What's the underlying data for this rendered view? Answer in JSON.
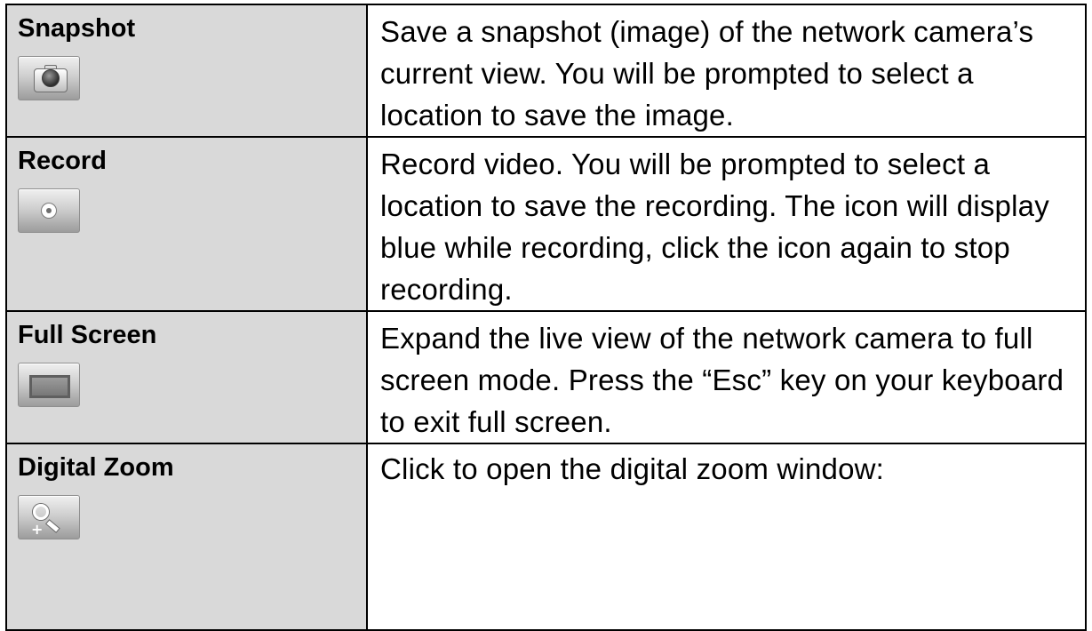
{
  "rows": [
    {
      "name": "Snapshot",
      "icon": "camera-icon",
      "description": "Save a snapshot (image) of the network camera’s current view. You will be prompted to select a location to save the image."
    },
    {
      "name": "Record",
      "icon": "record-icon",
      "description": "Record video. You will be prompted to select a location to save the recording. The icon will display blue while recording, click the icon again to stop recording."
    },
    {
      "name": "Full Screen",
      "icon": "fullscreen-icon",
      "description": "Expand the live view of the network camera to full screen mode. Press the “Esc” key on your keyboard to exit full screen."
    },
    {
      "name": "Digital Zoom",
      "icon": "zoom-icon",
      "description": "Click to open the digital zoom window:"
    }
  ],
  "colors": {
    "name_cell_bg": "#d9d9d9",
    "border": "#000000"
  }
}
